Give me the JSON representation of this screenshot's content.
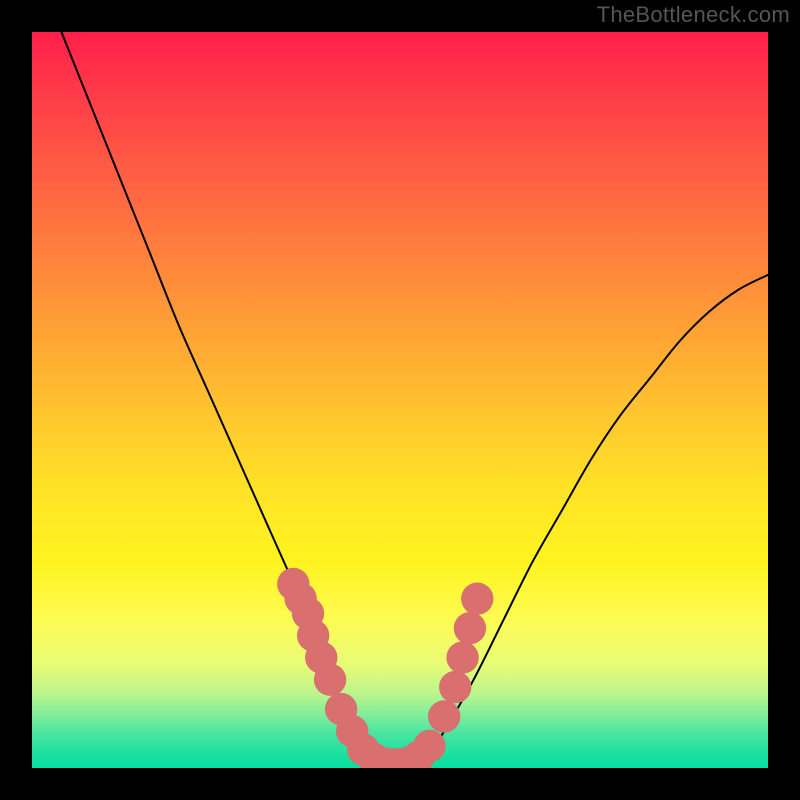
{
  "watermark": {
    "text": "TheBottleneck.com"
  },
  "chart_data": {
    "type": "line",
    "title": "",
    "xlabel": "",
    "ylabel": "",
    "xlim": [
      0,
      100
    ],
    "ylim": [
      0,
      100
    ],
    "grid": false,
    "gradient_colors": {
      "top": "#ff1f4a",
      "mid_upper": "#ffa036",
      "mid": "#ffe226",
      "mid_lower": "#fdfc54",
      "bottom": "#0adf9f"
    },
    "series": [
      {
        "name": "bottleneck-curve",
        "color": "#000000",
        "stroke_width": 2,
        "x": [
          4,
          8,
          12,
          16,
          20,
          24,
          28,
          32,
          36,
          38,
          40,
          42,
          44,
          46,
          48,
          50,
          52,
          54,
          56,
          60,
          64,
          68,
          72,
          76,
          80,
          84,
          88,
          92,
          96,
          100
        ],
        "y": [
          100,
          90,
          80,
          70,
          60,
          51,
          42,
          33,
          24,
          19,
          14,
          9,
          5,
          2,
          0.5,
          0.3,
          0.5,
          2,
          5,
          12,
          20,
          28,
          35,
          42,
          48,
          53,
          58,
          62,
          65,
          67
        ]
      }
    ],
    "points": {
      "name": "highlight-dots",
      "color": "#d96f6f",
      "radius": 2.2,
      "x": [
        35.5,
        36.5,
        37.5,
        38.2,
        39.3,
        40.5,
        42.0,
        43.5,
        45.0,
        46.5,
        48.0,
        49.5,
        51.0,
        52.5,
        54.0,
        56.0,
        57.5,
        58.5,
        59.5,
        60.5
      ],
      "y": [
        25,
        23,
        21,
        18,
        15,
        12,
        8,
        5,
        2.5,
        1.2,
        0.6,
        0.5,
        0.7,
        1.5,
        3,
        7,
        11,
        15,
        19,
        23
      ]
    }
  }
}
